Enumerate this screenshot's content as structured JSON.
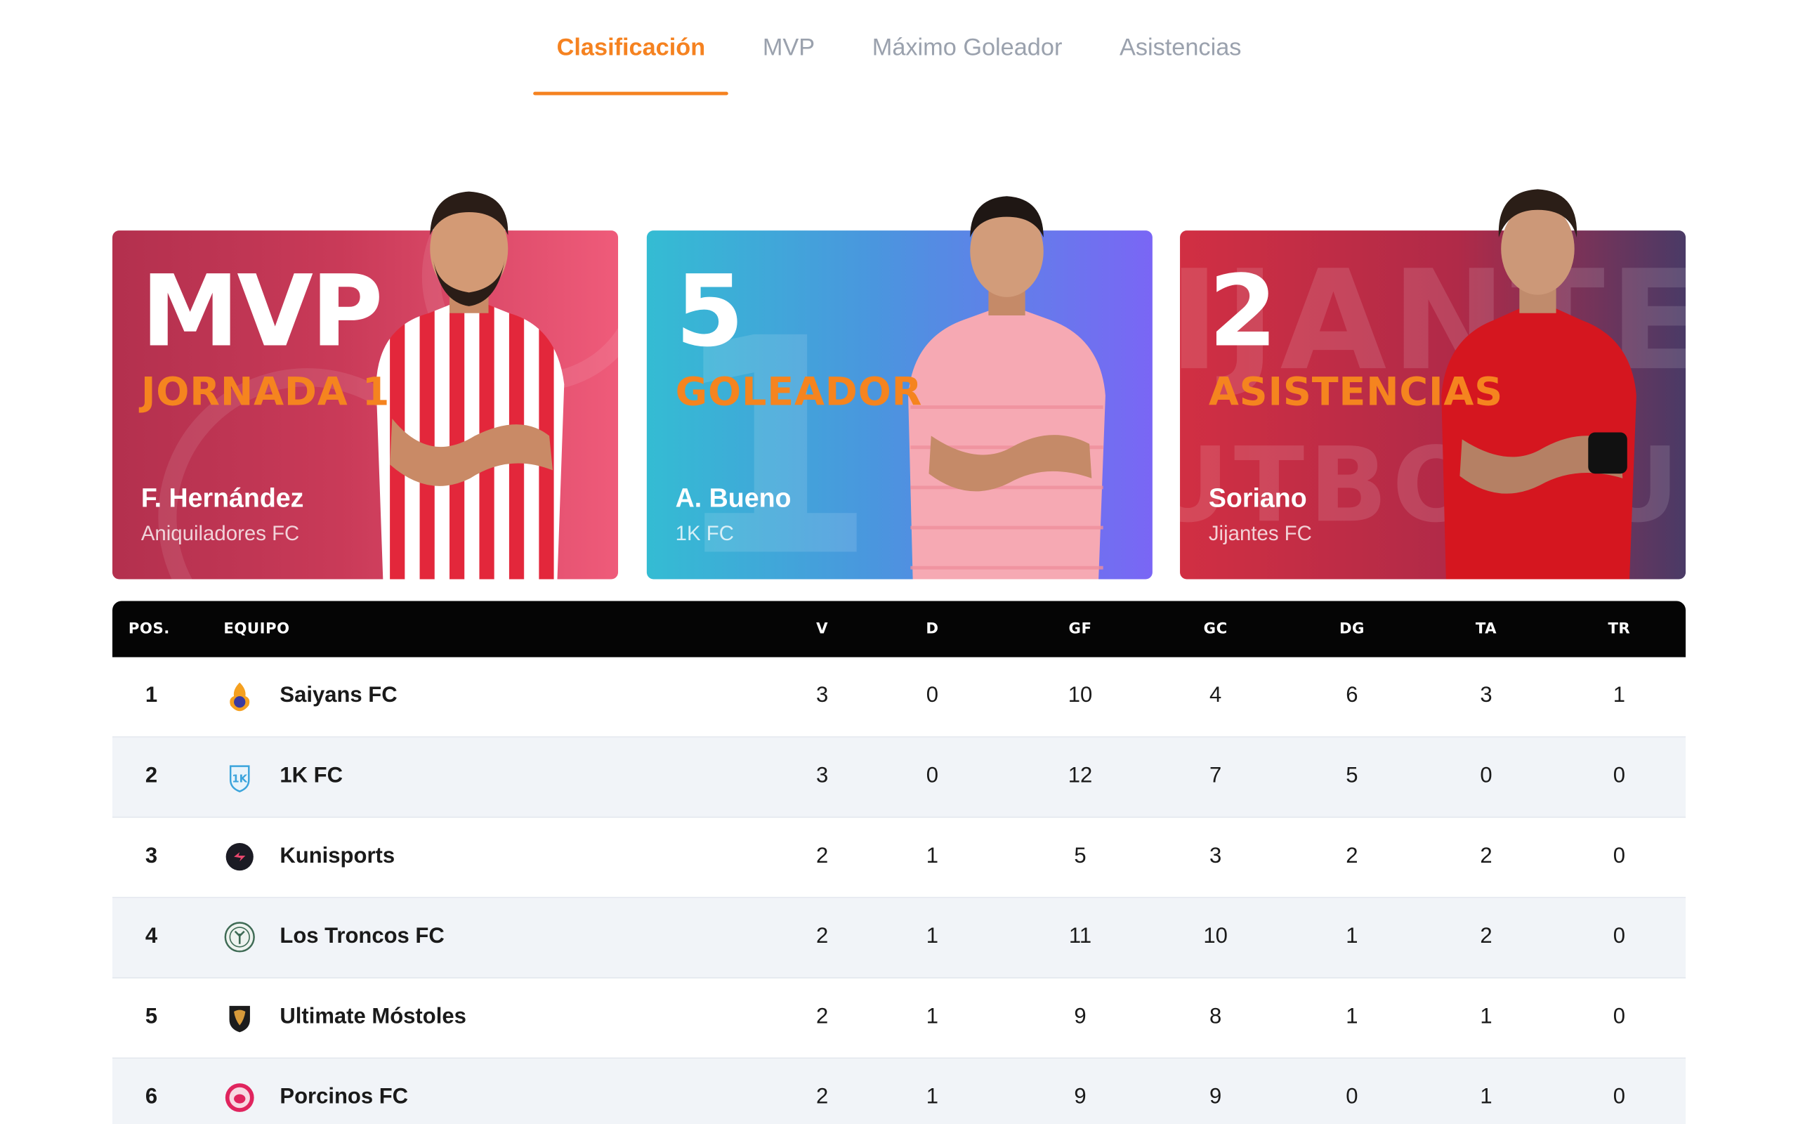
{
  "tabs": [
    {
      "label": "Clasificación",
      "active": true
    },
    {
      "label": "MVP",
      "active": false
    },
    {
      "label": "Máximo Goleador",
      "active": false
    },
    {
      "label": "Asistencias",
      "active": false
    }
  ],
  "cards": [
    {
      "big": "MVP",
      "sub": "JORNADA 1",
      "player": "F. Hernández",
      "team": "Aniquiladores FC",
      "kit_color": "#e3273b",
      "kit_stripe": "#ffffff"
    },
    {
      "big": "5",
      "sub": "GOLEADOR",
      "player": "A. Bueno",
      "team": "1K FC",
      "kit_color": "#f6a9b3",
      "kit_stripe": "#f08b98"
    },
    {
      "big": "2",
      "sub": "ASISTENCIAS",
      "player": "Soriano",
      "team": "Jijantes FC",
      "kit_color": "#d5161f",
      "kit_stripe": "#b30f18"
    }
  ],
  "table": {
    "headers": {
      "pos": "POS.",
      "team": "EQUIPO",
      "v": "V",
      "d": "D",
      "gf": "GF",
      "gc": "GC",
      "dg": "DG",
      "ta": "TA",
      "tr": "TR"
    },
    "rows": [
      {
        "pos": "1",
        "team": "Saiyans FC",
        "v": "3",
        "d": "0",
        "gf": "10",
        "gc": "4",
        "dg": "6",
        "ta": "3",
        "tr": "1"
      },
      {
        "pos": "2",
        "team": "1K FC",
        "v": "3",
        "d": "0",
        "gf": "12",
        "gc": "7",
        "dg": "5",
        "ta": "0",
        "tr": "0"
      },
      {
        "pos": "3",
        "team": "Kunisports",
        "v": "2",
        "d": "1",
        "gf": "5",
        "gc": "3",
        "dg": "2",
        "ta": "2",
        "tr": "0"
      },
      {
        "pos": "4",
        "team": "Los Troncos FC",
        "v": "2",
        "d": "1",
        "gf": "11",
        "gc": "10",
        "dg": "1",
        "ta": "2",
        "tr": "0"
      },
      {
        "pos": "5",
        "team": "Ultimate Móstoles",
        "v": "2",
        "d": "1",
        "gf": "9",
        "gc": "8",
        "dg": "1",
        "ta": "1",
        "tr": "0"
      },
      {
        "pos": "6",
        "team": "Porcinos FC",
        "v": "2",
        "d": "1",
        "gf": "9",
        "gc": "9",
        "dg": "0",
        "ta": "1",
        "tr": "0"
      }
    ]
  },
  "colors": {
    "accent": "#f58220",
    "header_bg": "#050505",
    "row_alt": "#f1f4f8"
  }
}
